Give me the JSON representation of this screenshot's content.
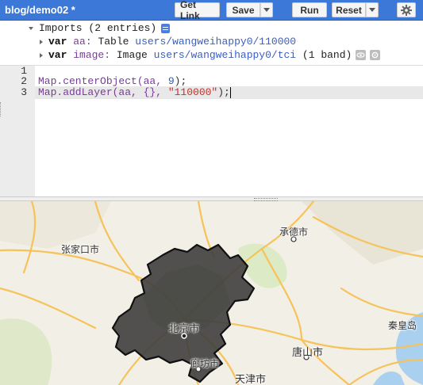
{
  "header": {
    "file_title": "blog/demo02 *",
    "buttons": {
      "get_link": "Get Link",
      "save": "Save",
      "run": "Run",
      "reset": "Reset"
    },
    "icons": {
      "settings": "gear-icon",
      "dropdown": "chevron-down-icon"
    }
  },
  "imports": {
    "header": "Imports (2 entries)",
    "entries": [
      {
        "keyword": "var",
        "name": "aa:",
        "type": "Table",
        "path": "users/wangweihappy0/110000",
        "extra": ""
      },
      {
        "keyword": "var",
        "name": "image:",
        "type": "Image",
        "path": "users/wangweihappy0/tci",
        "extra": "(1 band)"
      }
    ]
  },
  "editor": {
    "line_numbers": [
      "1",
      "2",
      "3"
    ],
    "lines": {
      "l2_a": "Map.centerObject(aa, ",
      "l2_num": "9",
      "l2_b": ");",
      "l3_a": "Map.addLayer(aa, {}, ",
      "l3_str": "\"110000\"",
      "l3_b": ");"
    }
  },
  "map": {
    "places": {
      "chengde": "承德市",
      "zhangjiakou": "张家口市",
      "beijing": "北京市",
      "qinhuangdao": "秦皇岛",
      "tangshan": "唐山市",
      "langfang": "廊坊市",
      "tianjin": "天津市"
    },
    "colors": {
      "land": "#f2efe6",
      "highway": "#f6c35a",
      "boundary_fill": "#3a3a3a",
      "water": "#a9d1ef",
      "park": "#c8dfa8"
    }
  }
}
